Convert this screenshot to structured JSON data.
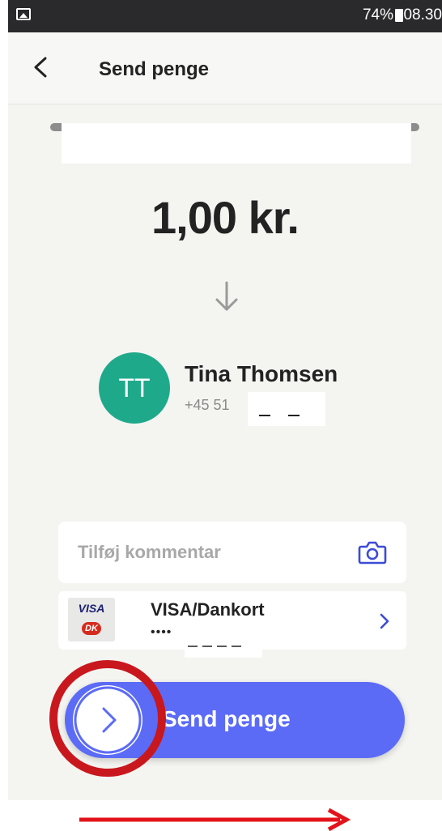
{
  "status_bar": {
    "battery_percent": "74%",
    "time": "08.30",
    "icons_text": "⚠ ⚲ ✱ ⏰ ☏ ≋ ▂▄▆"
  },
  "header": {
    "title": "Send penge"
  },
  "amount": {
    "value": "1,00 kr."
  },
  "recipient": {
    "initials": "TT",
    "name": "Tina Thomsen",
    "phone_prefix": "+45 51"
  },
  "comment": {
    "placeholder": "Tilføj kommentar"
  },
  "card": {
    "brand_visa": "VISA",
    "brand_dk": "DK",
    "name": "VISA/Dankort",
    "masked_number": "••••"
  },
  "send": {
    "label": "Send penge"
  },
  "colors": {
    "accent": "#5b6bf6",
    "avatar": "#1fa98b",
    "annotation_red": "#c8181e"
  }
}
